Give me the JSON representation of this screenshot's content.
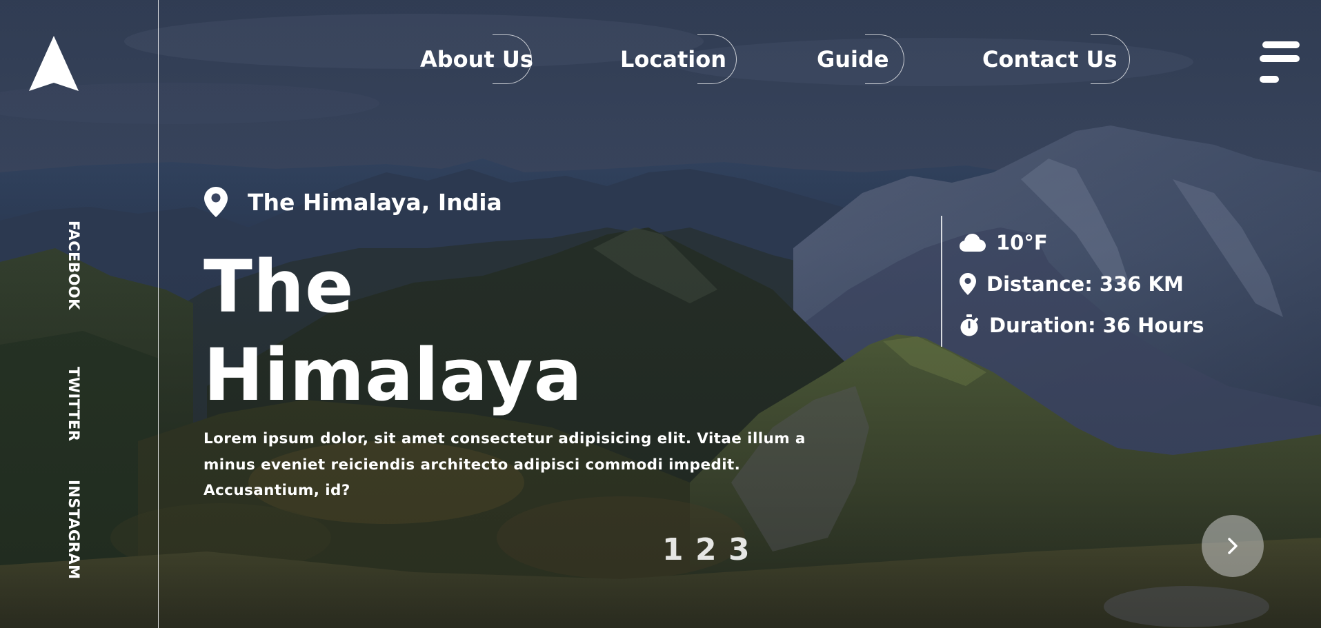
{
  "brand": {
    "logo_icon": "arrow-up-logo-icon"
  },
  "social": {
    "items": [
      {
        "label": "FACEBOOK"
      },
      {
        "label": "TWITTER"
      },
      {
        "label": "INSTAGRAM"
      }
    ]
  },
  "nav": {
    "items": [
      {
        "label": "About Us"
      },
      {
        "label": "Location"
      },
      {
        "label": "Guide"
      },
      {
        "label": "Contact Us"
      }
    ],
    "menu_icon": "hamburger-menu-icon"
  },
  "hero": {
    "location_icon": "map-pin-icon",
    "location": "The Himalaya, India",
    "title_line1": "The",
    "title_line2": "Himalaya",
    "description": "Lorem ipsum dolor, sit amet consectetur adipisicing elit. Vitae illum a minus eveniet reiciendis architecto adipisci commodi impedit. Accusantium, id?"
  },
  "info": {
    "temperature": {
      "icon": "cloud-icon",
      "text": "10°F"
    },
    "distance": {
      "icon": "map-pin-icon",
      "text": "Distance: 336 KM"
    },
    "duration": {
      "icon": "stopwatch-icon",
      "text": "Duration: 36 Hours"
    }
  },
  "pagination": {
    "pages": [
      "1",
      "2",
      "3"
    ]
  },
  "next_button": {
    "icon": "chevron-right-icon"
  },
  "colors": {
    "text": "#ffffff",
    "next_button_bg": "#c8c8c8"
  }
}
